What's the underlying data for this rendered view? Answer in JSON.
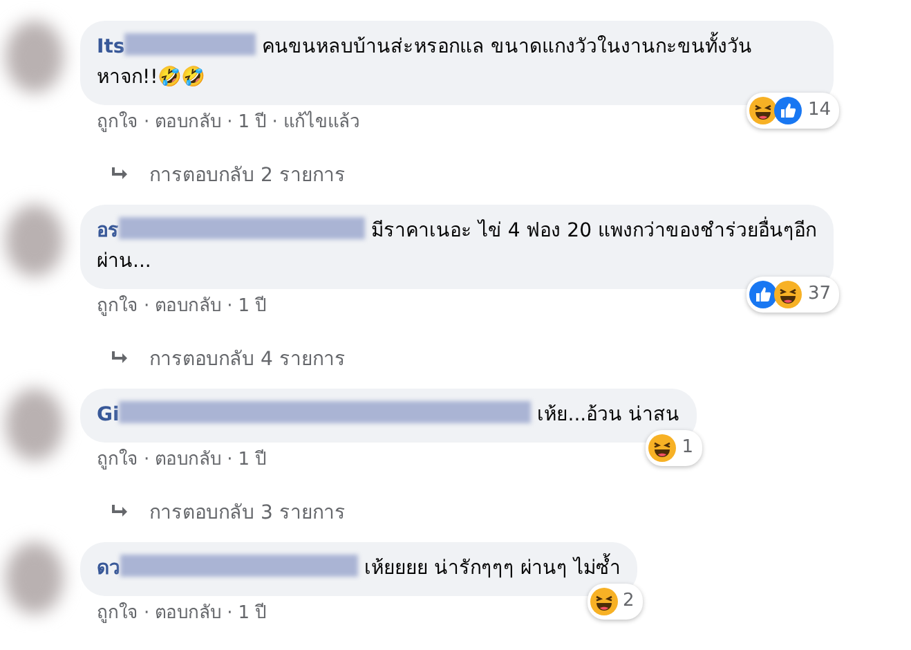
{
  "separator": "·",
  "comments": [
    {
      "name": "Its",
      "text": "คนขนหลบบ้านส่ะหรอกแล ขนาดแกงวัวในงานกะขนทั้งวัน หาจก!!🤣🤣",
      "reactions": [
        {
          "kind": "haha"
        },
        {
          "kind": "like"
        }
      ],
      "reaction_count": "14",
      "actions": [
        "ถูกใจ",
        "ตอบกลับ",
        "1 ปี",
        "แก้ไขแล้ว"
      ],
      "replies": "การตอบกลับ 2 รายการ"
    },
    {
      "name": "อร",
      "text": "มีราคาเนอะ ไข่ 4 ฟอง 20 แพงกว่าของชำร่วยอื่นๆอีก ผ่าน...",
      "reactions": [
        {
          "kind": "like"
        },
        {
          "kind": "haha"
        }
      ],
      "reaction_count": "37",
      "actions": [
        "ถูกใจ",
        "ตอบกลับ",
        "1 ปี"
      ],
      "replies": "การตอบกลับ 4 รายการ"
    },
    {
      "name": "Gi",
      "text": "เห้ย...อ้วน น่าสน",
      "reactions": [
        {
          "kind": "haha"
        }
      ],
      "reaction_count": "1",
      "actions": [
        "ถูกใจ",
        "ตอบกลับ",
        "1 ปี"
      ],
      "replies": "การตอบกลับ 3 รายการ"
    },
    {
      "name": "ดว",
      "text": "เห้ยยยย น่ารักๆๆๆ ผ่านๆ ไม่ซ้ำ",
      "reactions": [
        {
          "kind": "haha"
        }
      ],
      "reaction_count": "2",
      "actions": [
        "ถูกใจ",
        "ตอบกลับ",
        "1 ปี"
      ]
    }
  ]
}
